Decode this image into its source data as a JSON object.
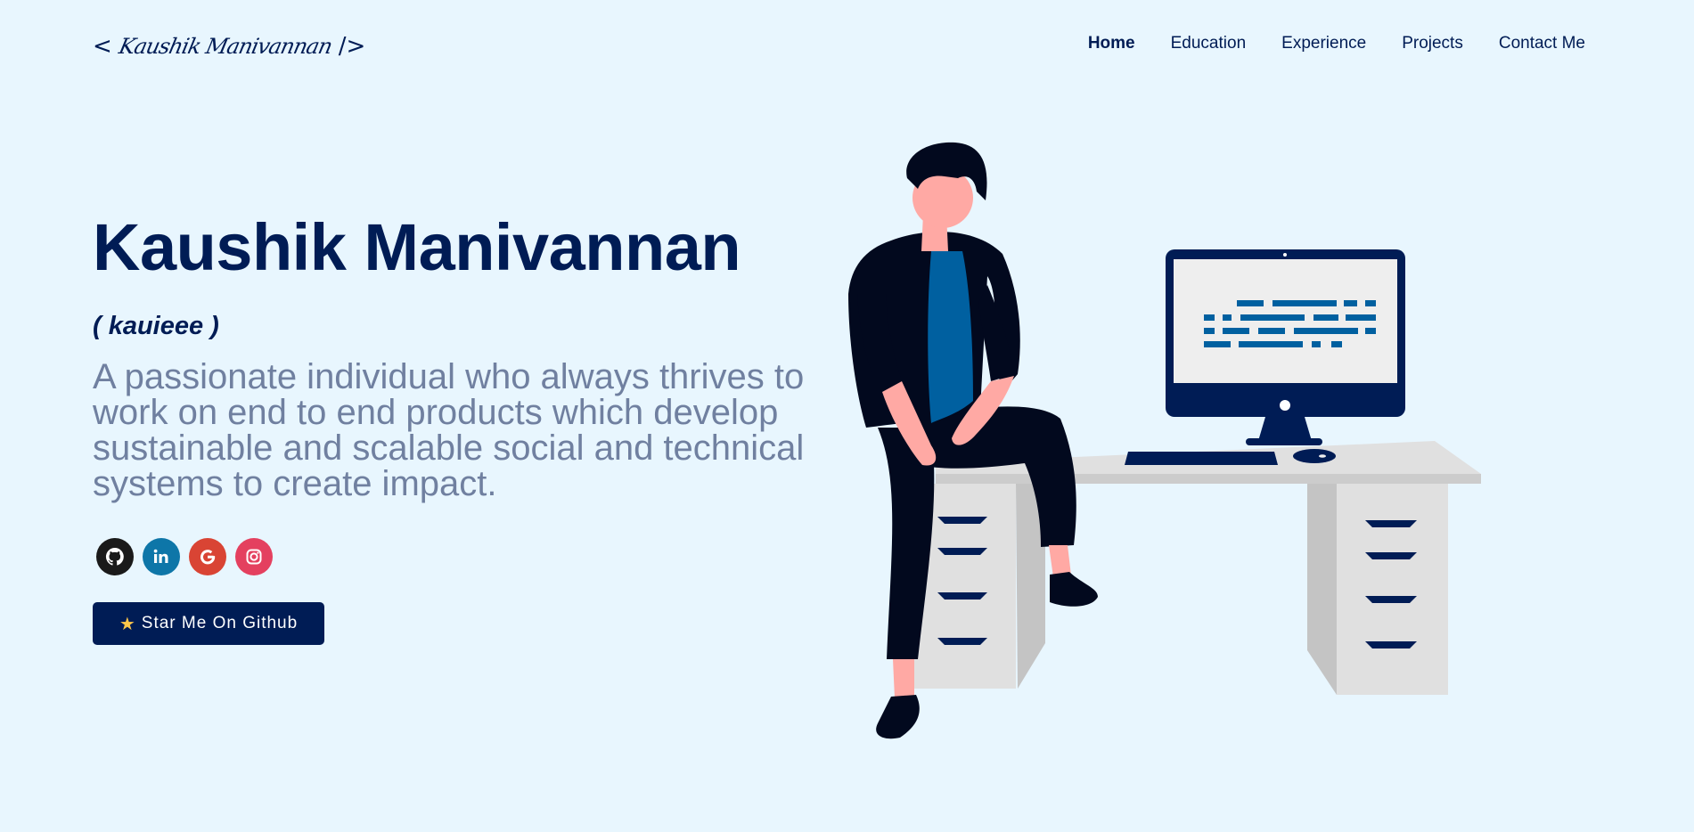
{
  "logo": {
    "open_bracket": "<",
    "script_name": "Kaushik Manivannan",
    "close_bracket": "/>"
  },
  "nav": {
    "items": [
      "Home",
      "Education",
      "Experience",
      "Projects",
      "Contact Me"
    ],
    "active": "Home"
  },
  "hero": {
    "name": "Kaushik Manivannan",
    "nickname": "( kauieee )",
    "tagline": "A passionate individual who always thrives to work on end to end products which develop sustainable and scalable social and technical systems to create impact."
  },
  "socials": [
    {
      "name": "github-icon",
      "color": "#1a1a1a"
    },
    {
      "name": "linkedin-icon",
      "color": "#0e76a8"
    },
    {
      "name": "google-icon",
      "color": "#d94434"
    },
    {
      "name": "instagram-icon",
      "color": "#e4405f"
    }
  ],
  "star_button": {
    "icon": "star-icon",
    "label": "Star Me On Github"
  },
  "colors": {
    "background": "#e8f6fe",
    "primary": "#001c55",
    "tagline": "#7080a0",
    "accent_blue": "#0060a0"
  }
}
